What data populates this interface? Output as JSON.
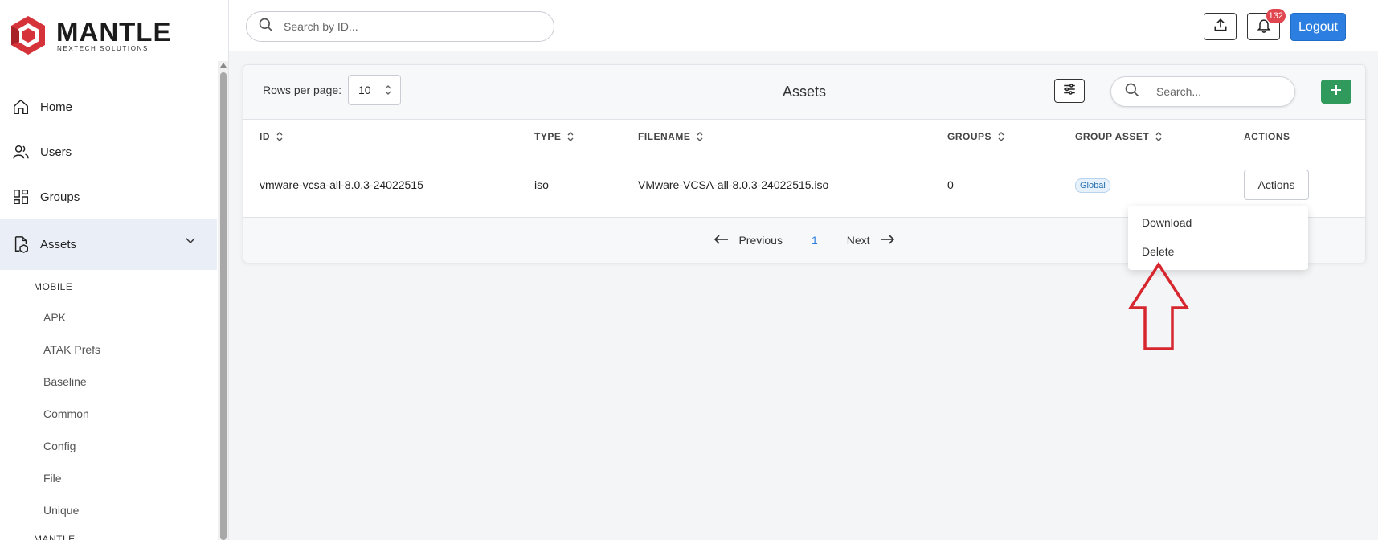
{
  "brand": {
    "name": "MANTLE",
    "tagline": "NEXTECH SOLUTIONS",
    "color": "#d6323a"
  },
  "sidebar": {
    "nav": [
      {
        "label": "Home",
        "icon": "home-icon"
      },
      {
        "label": "Users",
        "icon": "users-icon"
      },
      {
        "label": "Groups",
        "icon": "groups-icon"
      },
      {
        "label": "Assets",
        "icon": "assets-icon",
        "active": true
      }
    ],
    "section_mobile": "MOBILE",
    "sub_items": [
      "APK",
      "ATAK Prefs",
      "Baseline",
      "Common",
      "Config",
      "File",
      "Unique"
    ],
    "section_next": "MANTLE"
  },
  "topbar": {
    "search_placeholder": "Search by ID...",
    "notification_count": "132",
    "logout_label": "Logout"
  },
  "assets_table": {
    "rows_per_page_label": "Rows per page:",
    "rows_per_page_value": "10",
    "title": "Assets",
    "search_placeholder": "Search...",
    "columns": [
      "ID",
      "TYPE",
      "FILENAME",
      "GROUPS",
      "GROUP ASSET",
      "ACTIONS"
    ],
    "rows": [
      {
        "id": "vmware-vcsa-all-8.0.3-24022515",
        "type": "iso",
        "filename": "VMware-VCSA-all-8.0.3-24022515.iso",
        "groups": "0",
        "group_asset": "Global",
        "actions_label": "Actions"
      }
    ],
    "pager": {
      "previous": "Previous",
      "current": "1",
      "next": "Next"
    }
  },
  "actions_menu": {
    "items": [
      "Download",
      "Delete"
    ]
  },
  "colors": {
    "primary": "#2c7fe0",
    "add_button": "#2f9a5b",
    "badge": "#e0464f",
    "annotation_arrow": "#d6262e"
  }
}
